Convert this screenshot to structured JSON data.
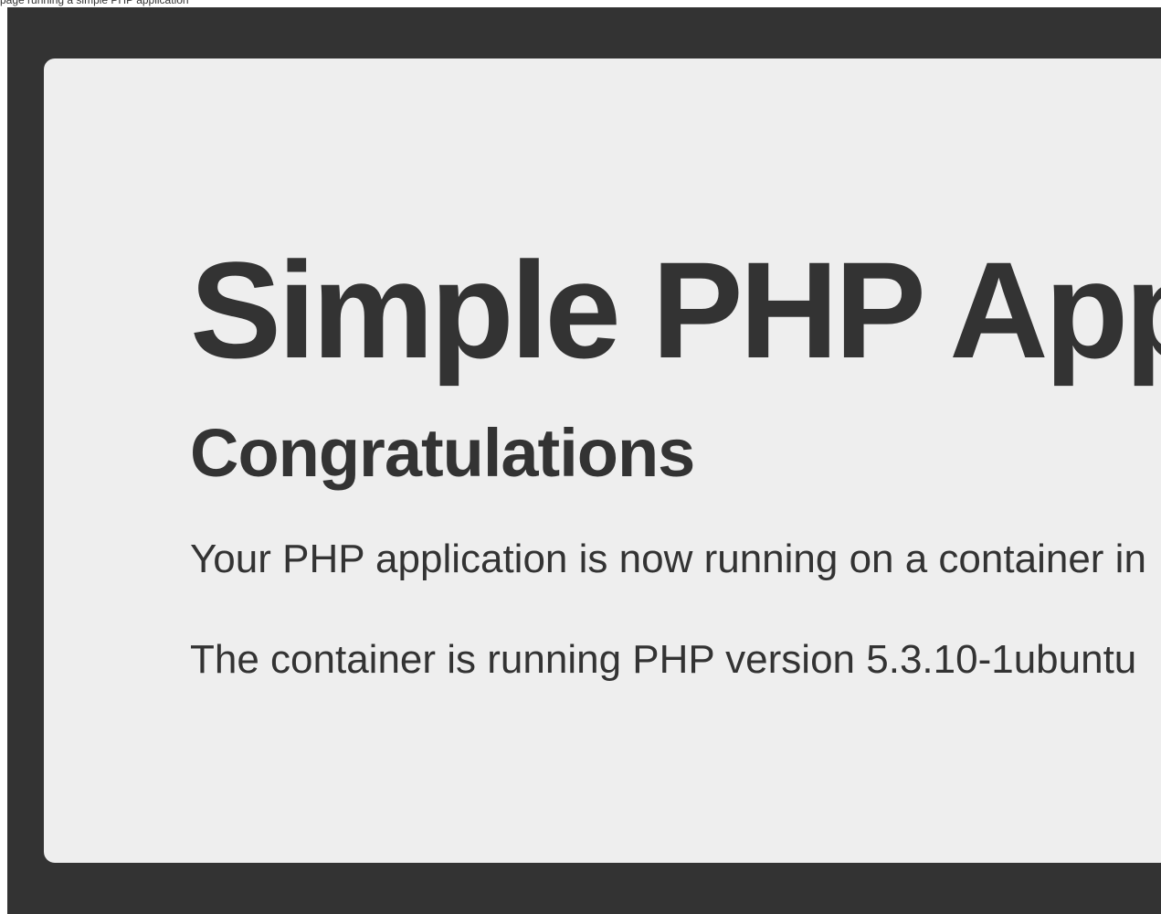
{
  "browser": {
    "tab_caption": "page running a simple PHP application"
  },
  "page": {
    "title": "Simple PHP App",
    "subtitle": "Congratulations",
    "paragraphs": [
      "Your PHP application is now running on a container in",
      "The container is running PHP version 5.3.10-1ubuntu"
    ]
  },
  "colors": {
    "background": "#333333",
    "panel": "#eeeeee",
    "text": "#333333"
  }
}
